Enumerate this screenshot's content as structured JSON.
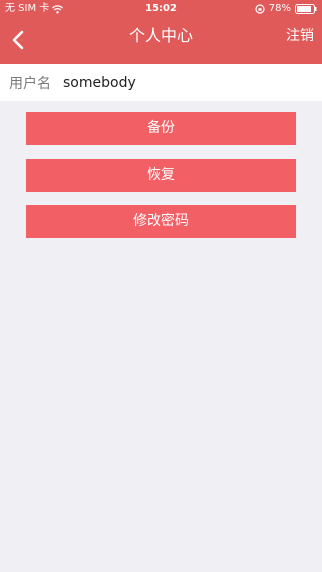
{
  "status_bar": {
    "carrier": "无 SIM 卡",
    "time": "15:02",
    "battery": "78%"
  },
  "nav": {
    "title": "个人中心",
    "logout_label": "注销"
  },
  "user": {
    "label": "用户名",
    "value": "somebody"
  },
  "actions": {
    "backup_label": "备份",
    "restore_label": "恢复",
    "change_password_label": "修改密码"
  },
  "colors": {
    "header": "#e15a5a",
    "button": "#f25f64",
    "background": "#efeff4"
  }
}
